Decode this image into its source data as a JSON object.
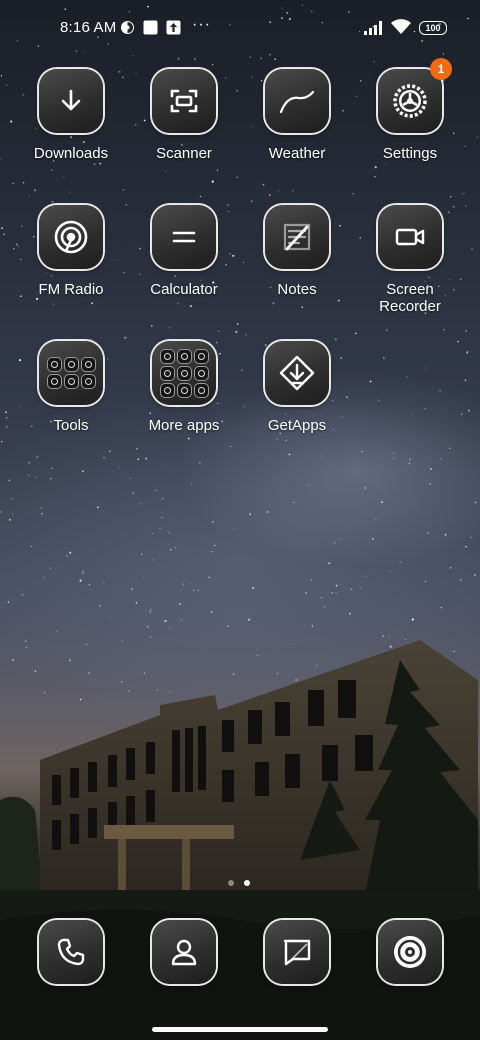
{
  "status_bar": {
    "time": "8:16 AM",
    "battery": "100",
    "more": "···"
  },
  "apps": [
    {
      "label": "Downloads",
      "icon": "download-icon"
    },
    {
      "label": "Scanner",
      "icon": "scanner-icon"
    },
    {
      "label": "Weather",
      "icon": "weather-icon"
    },
    {
      "label": "Settings",
      "icon": "gear-icon",
      "badge": "1"
    },
    {
      "label": "FM Radio",
      "icon": "radio-icon"
    },
    {
      "label": "Calculator",
      "icon": "calculator-icon"
    },
    {
      "label": "Notes",
      "icon": "notes-icon"
    },
    {
      "label": "Screen\nRecorder",
      "icon": "video-camera-icon"
    },
    {
      "label": "Tools",
      "icon": "folder-icon"
    },
    {
      "label": "More apps",
      "icon": "folder-icon"
    },
    {
      "label": "GetApps",
      "icon": "getapps-icon"
    }
  ],
  "dock": [
    {
      "icon": "phone-icon"
    },
    {
      "icon": "contacts-icon"
    },
    {
      "icon": "messages-icon"
    },
    {
      "icon": "browser-icon"
    }
  ],
  "colors": {
    "badge": "#f26a12",
    "tile": "#2e2e2e",
    "tile_border": "#e8e8e8"
  },
  "page_indicator": {
    "count": 2,
    "active": 2
  }
}
